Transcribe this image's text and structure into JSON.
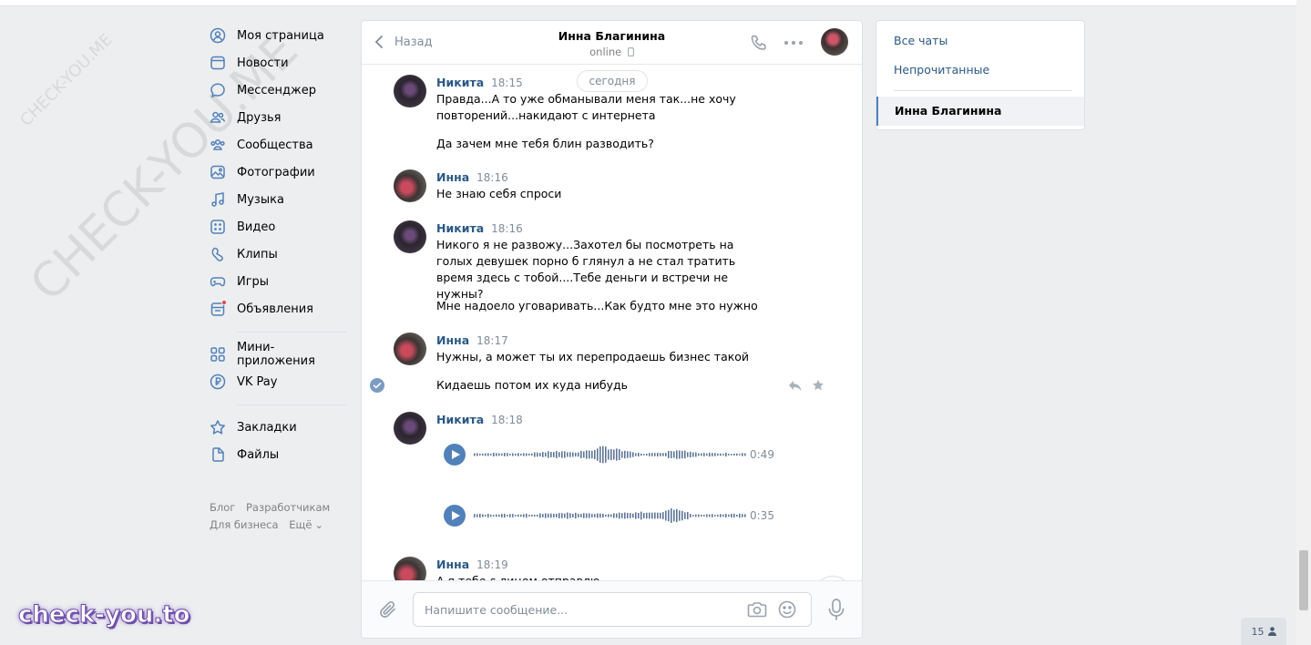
{
  "watermark": {
    "small": "CHECK-YOU.ME",
    "large": "CHECK-YOU.ME",
    "brand": "check-you.to"
  },
  "nav": {
    "items": [
      {
        "label": "Моя страница",
        "icon": "user-circle-icon"
      },
      {
        "label": "Новости",
        "icon": "news-icon"
      },
      {
        "label": "Мессенджер",
        "icon": "message-icon"
      },
      {
        "label": "Друзья",
        "icon": "friends-icon"
      },
      {
        "label": "Сообщества",
        "icon": "communities-icon"
      },
      {
        "label": "Фотографии",
        "icon": "photo-icon"
      },
      {
        "label": "Музыка",
        "icon": "music-icon"
      },
      {
        "label": "Видео",
        "icon": "video-icon"
      },
      {
        "label": "Клипы",
        "icon": "clips-icon"
      },
      {
        "label": "Игры",
        "icon": "gamepad-icon"
      },
      {
        "label": "Объявления",
        "icon": "ads-icon"
      }
    ],
    "apps": [
      {
        "label": "Мини-приложения",
        "icon": "apps-grid-icon"
      },
      {
        "label": "VK Pay",
        "icon": "vkpay-icon"
      }
    ],
    "saved": [
      {
        "label": "Закладки",
        "icon": "star-icon"
      },
      {
        "label": "Файлы",
        "icon": "file-icon"
      }
    ],
    "footer": {
      "blog": "Блог",
      "dev": "Разработчикам",
      "business": "Для бизнеса",
      "more": "Ещё"
    }
  },
  "chat": {
    "back_label": "Назад",
    "peer_name": "Инна Благинина",
    "peer_status": "online",
    "date_divider": "сегодня",
    "messages": [
      {
        "author": "Никита",
        "time": "18:15",
        "lines": [
          "Правда...А то уже обманывали меня так...не хочу повторений...накидают с интернета",
          "Да зачем мне тебя блин разводить?"
        ]
      },
      {
        "author": "Инна",
        "time": "18:16",
        "lines": [
          "Не знаю себя спроси"
        ]
      },
      {
        "author": "Никита",
        "time": "18:16",
        "lines": [
          "Никого я не развожу...Захотел бы посмотреть на голых девушек порно б глянул а не стал тратить время здесь с тобой....Тебе деньги и встречи не нужны?",
          "Мне надоело уговаривать...Как будто мне это нужно"
        ]
      },
      {
        "author": "Инна",
        "time": "18:17",
        "lines": [
          "Нужны, а может ты их перепродаешь бизнес такой",
          "Кидаешь потом их куда нибудь"
        ]
      },
      {
        "author": "Никита",
        "time": "18:18",
        "voices": [
          "0:49",
          "0:35"
        ]
      },
      {
        "author": "Инна",
        "time": "18:19",
        "lines": [
          "А я тебе с лицом отправлю"
        ]
      }
    ],
    "composer_placeholder": "Напишите сообщение..."
  },
  "right_panel": {
    "all_chats": "Все чаты",
    "unread": "Непрочитанные",
    "active_chat": "Инна Благинина"
  },
  "online_badge": "15",
  "colors": {
    "link": "#2a5885",
    "accent": "#5181b8",
    "muted": "#818c99",
    "bg": "#edeef0"
  }
}
